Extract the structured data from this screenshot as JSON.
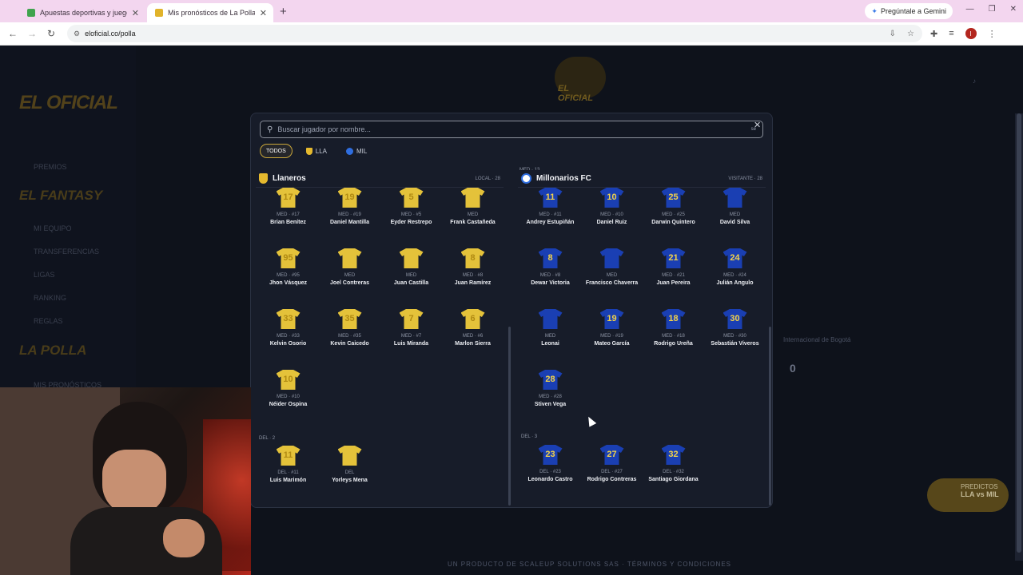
{
  "browser": {
    "tabs": [
      {
        "title": "Apuestas deportivas y juegos d",
        "active": false
      },
      {
        "title": "Mis pronósticos de La Polla — E",
        "active": true
      }
    ],
    "url": "eloficial.co/polla",
    "gemini_label": "Pregúntale a Gemini",
    "profile_initial": "I"
  },
  "background": {
    "brand": "EL OFICIAL",
    "sidebar_items": [
      "PREMIOS",
      "MI EQUIPO",
      "TRANSFERENCIAS",
      "LIGAS",
      "RANKING",
      "REGLAS",
      "MIS PRONÓSTICOS"
    ],
    "sidebar_heads": [
      "EL FANTASY",
      "LA POLLA"
    ],
    "header_logo": "EL OFICIAL",
    "match_team": "Internacional de Bogotá",
    "score": "0",
    "predict_button": {
      "line1": "PREDICTOS",
      "line2": "LLA vs MIL"
    },
    "footer": "UN PRODUCTO DE SCALEUP SOLUTIONS SAS · TÉRMINOS Y CONDICIONES"
  },
  "modal": {
    "search_placeholder": "Buscar jugador por nombre...",
    "esc_hint": "se",
    "filters": [
      {
        "label": "TODOS",
        "active": true
      },
      {
        "label": "LLA",
        "active": false
      },
      {
        "label": "MIL",
        "active": false
      }
    ],
    "left": {
      "team": "Llaneros",
      "meta": "LOCAL · 28",
      "med_players": [
        {
          "num": "17",
          "pos": "MED · #17",
          "name": "Brian Benítez"
        },
        {
          "num": "19",
          "pos": "MED · #19",
          "name": "Daniel Mantilla"
        },
        {
          "num": "5",
          "pos": "MED · #5",
          "name": "Eyder Restrepo"
        },
        {
          "num": "",
          "pos": "MED",
          "name": "Frank Castañeda"
        },
        {
          "num": "95",
          "pos": "MED · #95",
          "name": "Jhon Vásquez"
        },
        {
          "num": "",
          "pos": "MED",
          "name": "Joel Contreras"
        },
        {
          "num": "",
          "pos": "MED",
          "name": "Juan Castilla"
        },
        {
          "num": "8",
          "pos": "MED · #8",
          "name": "Juan Ramírez"
        },
        {
          "num": "33",
          "pos": "MED · #33",
          "name": "Kelvin Osorio"
        },
        {
          "num": "35",
          "pos": "MED · #35",
          "name": "Kevin Caicedo"
        },
        {
          "num": "7",
          "pos": "MED · #7",
          "name": "Luis Miranda"
        },
        {
          "num": "6",
          "pos": "MED · #6",
          "name": "Marlon Sierra"
        },
        {
          "num": "10",
          "pos": "MED · #10",
          "name": "Néider Ospina"
        }
      ],
      "del_label": "DEL · 2",
      "del_players": [
        {
          "num": "11",
          "pos": "DEL · #11",
          "name": "Luis Marimón"
        },
        {
          "num": "",
          "pos": "DEL",
          "name": "Yorleys Mena"
        }
      ]
    },
    "right": {
      "team": "Millonarios FC",
      "meta": "VISITANTE · 28",
      "top_label": "MED · 13",
      "med_players": [
        {
          "num": "11",
          "pos": "MED · #11",
          "name": "Andrey Estupiñán"
        },
        {
          "num": "10",
          "pos": "MED · #10",
          "name": "Daniel Ruiz"
        },
        {
          "num": "25",
          "pos": "MED · #25",
          "name": "Darwin Quintero"
        },
        {
          "num": "",
          "pos": "MED",
          "name": "David Silva"
        },
        {
          "num": "8",
          "pos": "MED · #8",
          "name": "Dewar Victoria"
        },
        {
          "num": "",
          "pos": "MED",
          "name": "Francisco Chaverra"
        },
        {
          "num": "21",
          "pos": "MED · #21",
          "name": "Juan Pereira"
        },
        {
          "num": "24",
          "pos": "MED · #24",
          "name": "Julián Angulo"
        },
        {
          "num": "",
          "pos": "MED",
          "name": "Leonai"
        },
        {
          "num": "19",
          "pos": "MED · #19",
          "name": "Mateo García"
        },
        {
          "num": "18",
          "pos": "MED · #18",
          "name": "Rodrigo Ureña"
        },
        {
          "num": "30",
          "pos": "MED · #30",
          "name": "Sebastián Viveros"
        },
        {
          "num": "28",
          "pos": "MED · #28",
          "name": "Stiven Vega"
        }
      ],
      "del_label": "DEL · 3",
      "del_players": [
        {
          "num": "23",
          "pos": "DEL · #23",
          "name": "Leonardo Castro"
        },
        {
          "num": "27",
          "pos": "DEL · #27",
          "name": "Rodrigo Contreras"
        },
        {
          "num": "32",
          "pos": "DEL · #32",
          "name": "Santiago Giordana"
        }
      ]
    }
  },
  "colors": {
    "llaneros_kit": "#e4c23a",
    "millonarios_kit": "#1a3fb3",
    "accent": "#c9a63a"
  }
}
